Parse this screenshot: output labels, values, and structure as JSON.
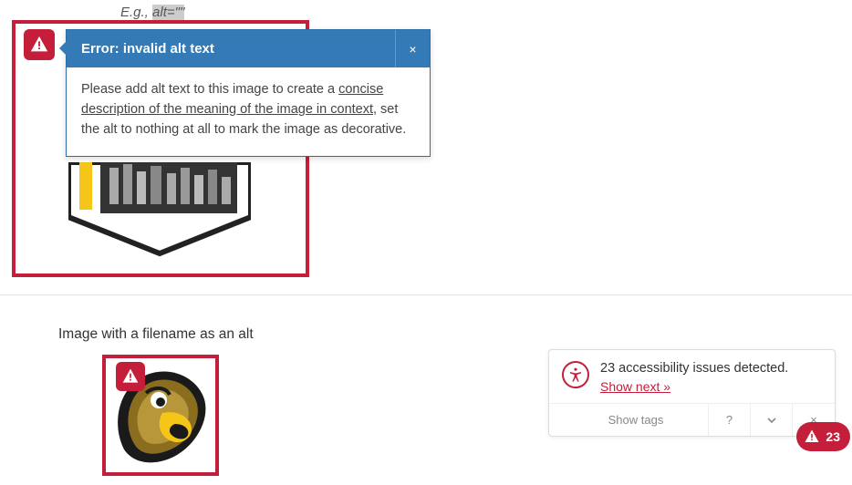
{
  "eg": {
    "prefix": "E.g., ",
    "code": "alt=\"\""
  },
  "tooltip": {
    "title": "Error: invalid alt text",
    "close": "×",
    "body_pre": "Please add alt text to this image to create a ",
    "link_text": "concise description of the meaning of the image in context",
    "body_post": ", set the alt to nothing at all to mark the image as decorative."
  },
  "caption2": "Image with a filename as an alt",
  "panel": {
    "message": "23 accessibility issues detected.",
    "show_next": "Show next »",
    "show_tags": "Show tags",
    "help": "?",
    "close": "×",
    "count": "23"
  }
}
